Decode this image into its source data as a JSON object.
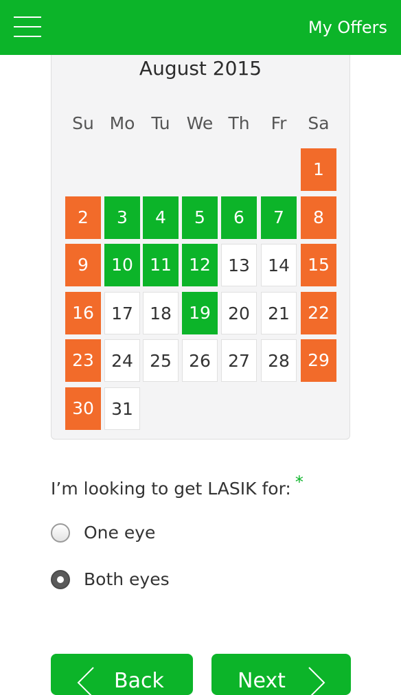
{
  "header": {
    "menu_icon": "hamburger-icon",
    "my_offers": "My Offers"
  },
  "calendar": {
    "month_title": "August 2015",
    "weekdays": [
      "Su",
      "Mo",
      "Tu",
      "We",
      "Th",
      "Fr",
      "Sa"
    ],
    "colors": {
      "weekend_unavailable": "#f26b2a",
      "available": "#0cb429",
      "open": "#ffffff"
    },
    "weeks": [
      [
        null,
        null,
        null,
        null,
        null,
        null,
        {
          "day": "1",
          "status": "weekend"
        }
      ],
      [
        {
          "day": "2",
          "status": "weekend"
        },
        {
          "day": "3",
          "status": "avail"
        },
        {
          "day": "4",
          "status": "avail"
        },
        {
          "day": "5",
          "status": "avail"
        },
        {
          "day": "6",
          "status": "avail"
        },
        {
          "day": "7",
          "status": "avail"
        },
        {
          "day": "8",
          "status": "weekend"
        }
      ],
      [
        {
          "day": "9",
          "status": "weekend"
        },
        {
          "day": "10",
          "status": "avail"
        },
        {
          "day": "11",
          "status": "avail"
        },
        {
          "day": "12",
          "status": "avail"
        },
        {
          "day": "13",
          "status": "open"
        },
        {
          "day": "14",
          "status": "open"
        },
        {
          "day": "15",
          "status": "weekend"
        }
      ],
      [
        {
          "day": "16",
          "status": "weekend"
        },
        {
          "day": "17",
          "status": "open"
        },
        {
          "day": "18",
          "status": "open"
        },
        {
          "day": "19",
          "status": "avail"
        },
        {
          "day": "20",
          "status": "open"
        },
        {
          "day": "21",
          "status": "open"
        },
        {
          "day": "22",
          "status": "weekend"
        }
      ],
      [
        {
          "day": "23",
          "status": "weekend"
        },
        {
          "day": "24",
          "status": "open"
        },
        {
          "day": "25",
          "status": "open"
        },
        {
          "day": "26",
          "status": "open"
        },
        {
          "day": "27",
          "status": "open"
        },
        {
          "day": "28",
          "status": "open"
        },
        {
          "day": "29",
          "status": "weekend"
        }
      ],
      [
        {
          "day": "30",
          "status": "weekend"
        },
        {
          "day": "31",
          "status": "open"
        },
        null,
        null,
        null,
        null,
        null
      ]
    ]
  },
  "form": {
    "question": "I’m looking to get LASIK for:",
    "required_mark": "*",
    "options": [
      {
        "label": "One eye",
        "selected": false
      },
      {
        "label": "Both eyes",
        "selected": true
      }
    ]
  },
  "buttons": {
    "back": "Back",
    "next": "Next"
  },
  "theme": {
    "accent": "#0cb429",
    "orange": "#f26b2a"
  }
}
